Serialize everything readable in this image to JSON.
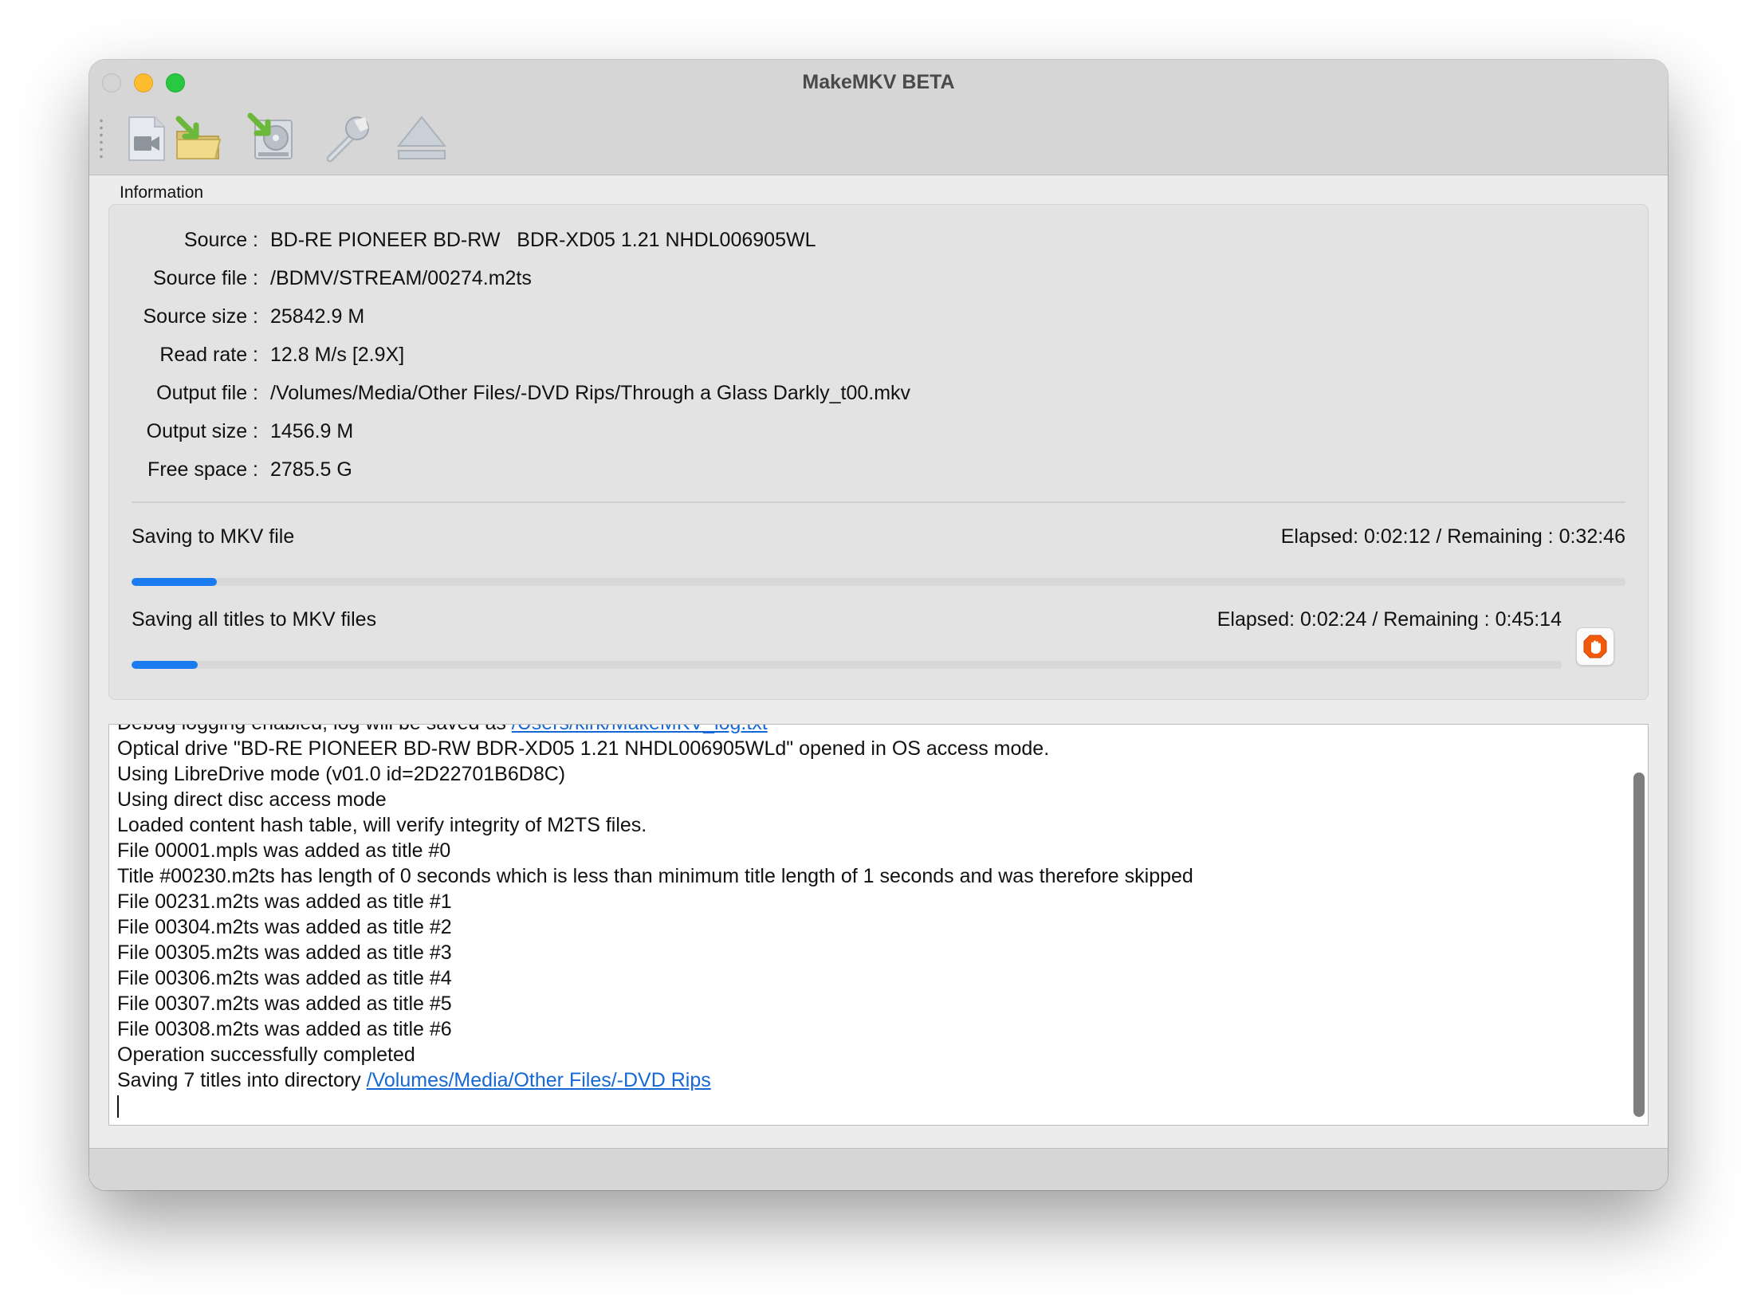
{
  "window": {
    "title": "MakeMKV BETA"
  },
  "toolbar": {
    "items": [
      {
        "name": "open-disc-icon"
      },
      {
        "name": "open-files-icon"
      },
      {
        "name": "backup-icon"
      },
      {
        "name": "preferences-wrench-icon"
      },
      {
        "name": "eject-icon"
      }
    ]
  },
  "info": {
    "group_title": "Information",
    "rows": [
      {
        "label": "Source :",
        "value": "BD-RE PIONEER BD-RW   BDR-XD05 1.21 NHDL006905WL"
      },
      {
        "label": "Source file :",
        "value": "/BDMV/STREAM/00274.m2ts"
      },
      {
        "label": "Source size :",
        "value": "25842.9 M"
      },
      {
        "label": "Read rate :",
        "value": "12.8 M/s [2.9X]"
      },
      {
        "label": "Output file :",
        "value": "/Volumes/Media/Other Files/-DVD Rips/Through a Glass Darkly_t00.mkv"
      },
      {
        "label": "Output size :",
        "value": "1456.9 M"
      },
      {
        "label": "Free space :",
        "value": "2785.5 G"
      }
    ]
  },
  "progress": {
    "current": {
      "label": "Saving to MKV file",
      "time": "Elapsed: 0:02:12 / Remaining : 0:32:46",
      "fraction": 0.057
    },
    "total": {
      "label": "Saving all titles to MKV files",
      "time": "Elapsed: 0:02:24 / Remaining : 0:45:14",
      "fraction": 0.046
    }
  },
  "log": {
    "lines": [
      {
        "text": "Debug logging enabled, log will be saved as ",
        "link": "/Users/kirk/MakeMKV_log.txt"
      },
      {
        "text": "Optical drive \"BD-RE PIONEER BD-RW BDR-XD05 1.21 NHDL006905WLd\" opened in OS access mode."
      },
      {
        "text": "Using LibreDrive mode (v01.0 id=2D22701B6D8C)"
      },
      {
        "text": "Using direct disc access mode"
      },
      {
        "text": "Loaded content hash table, will verify integrity of M2TS files."
      },
      {
        "text": "File 00001.mpls was added as title #0"
      },
      {
        "text": "Title #00230.m2ts has length of 0 seconds which is less than minimum title length of 1 seconds and was therefore skipped"
      },
      {
        "text": "File 00231.m2ts was added as title #1"
      },
      {
        "text": "File 00304.m2ts was added as title #2"
      },
      {
        "text": "File 00305.m2ts was added as title #3"
      },
      {
        "text": "File 00306.m2ts was added as title #4"
      },
      {
        "text": "File 00307.m2ts was added as title #5"
      },
      {
        "text": "File 00308.m2ts was added as title #6"
      },
      {
        "text": "Operation successfully completed"
      },
      {
        "text": "Saving 7 titles into directory ",
        "link": "/Volumes/Media/Other Files/-DVD Rips"
      }
    ]
  },
  "colors": {
    "accent": "#1a7cf0",
    "link": "#1668d4",
    "stop": "#f05a0a"
  }
}
